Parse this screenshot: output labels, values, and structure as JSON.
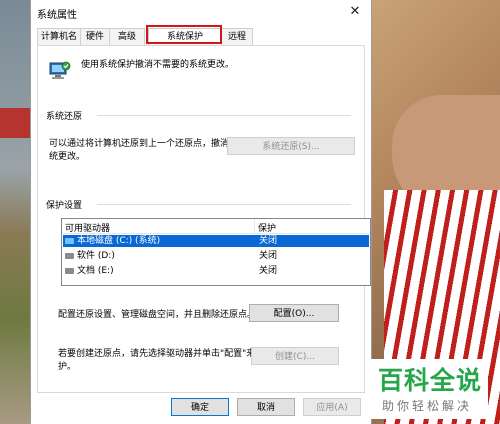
{
  "window": {
    "title": "系统属性",
    "close_glyph": "✕"
  },
  "tabs": [
    {
      "label": "计算机名"
    },
    {
      "label": "硬件"
    },
    {
      "label": "高级"
    },
    {
      "label": "系统保护"
    },
    {
      "label": "远程"
    }
  ],
  "active_tab": "系统保护",
  "intro": {
    "text": "使用系统保护撤消不需要的系统更改。",
    "icon": "system-protection-icon"
  },
  "restore": {
    "heading": "系统还原",
    "description": "可以通过将计算机还原到上一个还原点，撤消系统更改。",
    "button": "系统还原(S)..."
  },
  "protection": {
    "heading": "保护设置",
    "columns": [
      "可用驱动器",
      "保护"
    ],
    "drives": [
      {
        "name": "本地磁盘 (C:) (系统)",
        "protection": "关闭",
        "selected": true
      },
      {
        "name": "软件 (D:)",
        "protection": "关闭",
        "selected": false
      },
      {
        "name": "文档 (E:)",
        "protection": "关闭",
        "selected": false
      }
    ],
    "config_text": "配置还原设置、管理磁盘空间，并且删除还原点。",
    "config_button": "配置(O)...",
    "create_text": "若要创建还原点，请先选择驱动器并单击\"配置\"来启用保护。",
    "create_button": "创建(C)..."
  },
  "footer": {
    "ok": "确定",
    "cancel": "取消",
    "apply": "应用(A)"
  },
  "watermark": {
    "title": "百科全说",
    "subtitle": "助你轻松解决"
  },
  "colors": {
    "highlight_border": "#d0181b",
    "selection": "#0a68d4",
    "watermark_green": "#26a64a"
  }
}
